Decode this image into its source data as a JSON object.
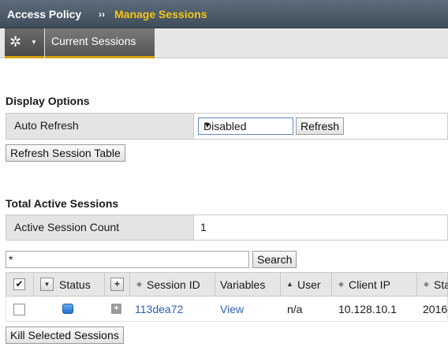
{
  "header": {
    "section": "Access Policy",
    "separator": "››",
    "page": "Manage Sessions"
  },
  "tabs": {
    "gear_icon": "gear-icon",
    "current_tab": "Current Sessions"
  },
  "display_options": {
    "title": "Display Options",
    "auto_refresh_label": "Auto Refresh",
    "auto_refresh_value": "Disabled",
    "refresh_button": "Refresh",
    "refresh_table_button": "Refresh Session Table"
  },
  "active_sessions": {
    "title": "Total Active Sessions",
    "count_label": "Active Session Count",
    "count_value": "1"
  },
  "search": {
    "value": "*",
    "button": "Search"
  },
  "table": {
    "columns": {
      "status": "Status",
      "session_id": "Session ID",
      "variables": "Variables",
      "user": "User",
      "client_ip": "Client IP",
      "start": "Sta"
    },
    "rows": [
      {
        "session_id": "113dea72",
        "variables": "View",
        "user": "n/a",
        "client_ip": "10.128.10.1",
        "start": "2016-"
      }
    ]
  },
  "kill_button": "Kill Selected Sessions",
  "colors": {
    "accent": "#d6a300",
    "title_highlight": "#f5c518",
    "link": "#2b5fb3",
    "status_active": "#1f6fcf"
  }
}
